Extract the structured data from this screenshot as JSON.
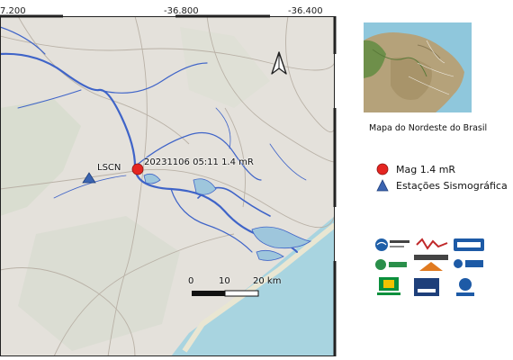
{
  "coordinates": {
    "ticks": [
      "7.200",
      "-36.800",
      "-36.400"
    ]
  },
  "map": {
    "event_label": "20231106 05:11 1.4 mR",
    "station_label": "LSCN",
    "scale": {
      "labels": [
        "0",
        "10",
        "20 km"
      ]
    },
    "colors": {
      "land": "#e4e1db",
      "water": "#3f64c8",
      "water_fill": "#9ec6dc",
      "sea": "#a8d4e0",
      "event": "#e52521",
      "station": "#3b64b0"
    }
  },
  "inset": {
    "caption": "Mapa do  Nordeste do Brasil"
  },
  "legend": {
    "items": [
      {
        "label": "Mag 1.4 mR",
        "symbol": "red-circle"
      },
      {
        "label": "Estações Sismográfica",
        "symbol": "blue-triangle"
      }
    ]
  },
  "logos": {
    "labsis": "LabSis UFRN",
    "rsisne": "RSISNE",
    "ufrn": "UFRN",
    "inct": "inct",
    "estudos": "ESTUDOS",
    "cnpq": "CNPq",
    "petrobras": "PETROBRAS",
    "asbr": "ASBR",
    "cprm": "CPRM"
  }
}
